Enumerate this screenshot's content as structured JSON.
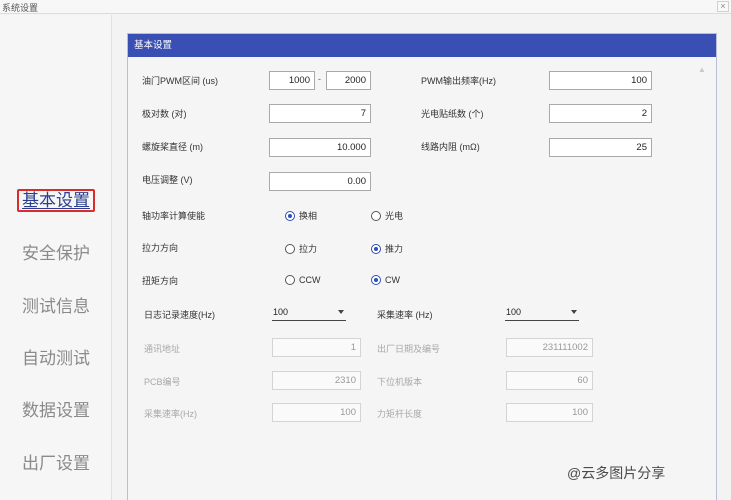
{
  "window": {
    "title": "系统设置",
    "close": "×"
  },
  "sidebar": {
    "items": [
      {
        "label": "基本设置"
      },
      {
        "label": "安全保护"
      },
      {
        "label": "测试信息"
      },
      {
        "label": "自动测试"
      },
      {
        "label": "数据设置"
      },
      {
        "label": "出厂设置"
      }
    ]
  },
  "panel": {
    "title": "基本设置",
    "scroll_icon": "▲",
    "throttle_pwm": {
      "label": "油门PWM区间 (us)",
      "min": "1000",
      "sep": "-",
      "max": "2000"
    },
    "pwm_freq": {
      "label": "PWM输出频率(Hz)",
      "value": "100"
    },
    "pole_pairs": {
      "label": "极对数 (对)",
      "value": "7"
    },
    "optical_stickers": {
      "label": "光电贴纸数 (个)",
      "value": "2"
    },
    "prop_diameter": {
      "label": "螺旋桨直径 (m)",
      "value": "10.000"
    },
    "line_resistance": {
      "label": "线路内阻 (mΩ)",
      "value": "25"
    },
    "voltage_adjust": {
      "label": "电压调整 (V)",
      "value": "0.00"
    },
    "shaft_power": {
      "label": "轴功率计算使能",
      "opt1": "换相",
      "opt2": "光电"
    },
    "tension_dir": {
      "label": "拉力方向",
      "opt1": "拉力",
      "opt2": "推力"
    },
    "torque_dir": {
      "label": "扭矩方向",
      "opt1": "CCW",
      "opt2": "CW"
    },
    "log_speed": {
      "label": "日志记录速度(Hz)",
      "value": "100"
    },
    "sample_rate": {
      "label": "采集速率 (Hz)",
      "value": "100"
    },
    "comm_addr": {
      "label": "通讯地址",
      "value": "1"
    },
    "factory_date": {
      "label": "出厂日期及编号",
      "value": "231111002"
    },
    "pcb_no": {
      "label": "PCB编号",
      "value": "2310"
    },
    "lower_version": {
      "label": "下位机版本",
      "value": "60"
    },
    "sample_rate2": {
      "label": "采集速率(Hz)",
      "value": "100"
    },
    "torque_arm": {
      "label": "力矩杆长度",
      "value": "100"
    }
  },
  "watermark": "@云多图片分享"
}
